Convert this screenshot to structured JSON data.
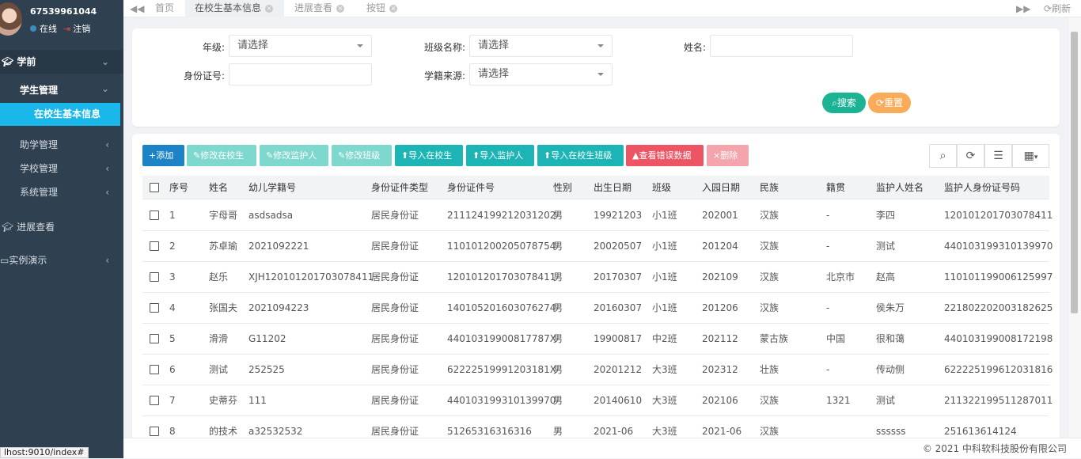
{
  "user": {
    "name": "67539961044",
    "status": "在线",
    "logout": "注销"
  },
  "sidebar": {
    "section": "学前",
    "open_group": "学生管理",
    "active_item": "在校生基本信息",
    "groups": [
      "助学管理",
      "学校管理",
      "系统管理"
    ],
    "top_items": [
      "进展查看",
      "实例演示"
    ]
  },
  "tabs": [
    {
      "label": "首页"
    },
    {
      "label": "在校生基本信息"
    },
    {
      "label": "进展查看"
    },
    {
      "label": "按钮"
    }
  ],
  "tab_refresh": "刷新",
  "search": {
    "grade_label": "年级:",
    "grade_value": "请选择",
    "class_label": "班级名称:",
    "class_value": "请选择",
    "name_label": "姓名:",
    "name_value": "",
    "id_label": "身份证号:",
    "id_value": "",
    "source_label": "学籍来源:",
    "source_value": "请选择",
    "search_btn": "搜索",
    "reset_btn": "重置"
  },
  "toolbar": {
    "add": "添加",
    "edit_student": "修改在校生",
    "edit_guardian": "修改监护人",
    "edit_class": "修改班级",
    "import_student": "导入在校生",
    "import_guardian": "导入监护人",
    "import_class": "导入在校生班级",
    "view_errors": "查看错误数据",
    "delete": "删除"
  },
  "colors": {
    "sidebar": "#2f4050",
    "active": "#1ab7ea",
    "primary": "#1c84c6",
    "teal": "#5fd3c4",
    "cyan": "#1cb4b4",
    "danger": "#ed5565",
    "warning": "#f8ac59",
    "search": "#1ab394"
  },
  "table": {
    "headers": [
      "序号",
      "姓名",
      "幼儿学籍号",
      "身份证件类型",
      "身份证件号",
      "性别",
      "出生日期",
      "班级",
      "入园日期",
      "民族",
      "籍贯",
      "监护人姓名",
      "监护人身份证号码"
    ],
    "rows": [
      [
        "1",
        "字母哥",
        "asdsadsa",
        "居民身份证",
        "211124199212031202",
        "男",
        "19921203",
        "小1班",
        "202001",
        "汉族",
        "-",
        "李四",
        "120101201703078411"
      ],
      [
        "2",
        "苏卓瑜",
        "2021092221",
        "居民身份证",
        "110101200205078754",
        "男",
        "20020507",
        "小1班",
        "201204",
        "汉族",
        "-",
        "测试",
        "440103199310139970"
      ],
      [
        "3",
        "赵乐",
        "XJH120101201703078411",
        "居民身份证",
        "120101201703078411",
        "男",
        "20170307",
        "小1班",
        "202109",
        "汉族",
        "北京市",
        "赵高",
        "110101199006125997"
      ],
      [
        "4",
        "张国夫",
        "2021094223",
        "居民身份证",
        "140105201603076274",
        "男",
        "20160307",
        "小1班",
        "201206",
        "汉族",
        "-",
        "侯朱万",
        "221802202003182625"
      ],
      [
        "5",
        "滑滑",
        "G11202",
        "居民身份证",
        "44010319900817787X",
        "男",
        "19900817",
        "中2班",
        "202112",
        "蒙古族",
        "中国",
        "很和蔼",
        "440103199008172198"
      ],
      [
        "6",
        "测试",
        "252525",
        "居民身份证",
        "62222519991203181X",
        "男",
        "20201212",
        "大3班",
        "202312",
        "壮族",
        "-",
        "传动侧",
        "622225199612031816"
      ],
      [
        "7",
        "史蒂芬",
        "111",
        "居民身份证",
        "440103199310139970",
        "男",
        "20140610",
        "大3班",
        "202106",
        "汉族",
        "1321",
        "测试",
        "211322199511287011"
      ],
      [
        "8",
        "的技术",
        "a32532532",
        "居民身份证",
        "51265316316316",
        "男",
        "2021-06",
        "大3班",
        "2021-06",
        "汉族",
        "",
        "ssssss",
        "251613614124"
      ]
    ]
  },
  "footer": "© 2021 中科软科技股份有限公司",
  "status_url": "lhost:9010/index#"
}
